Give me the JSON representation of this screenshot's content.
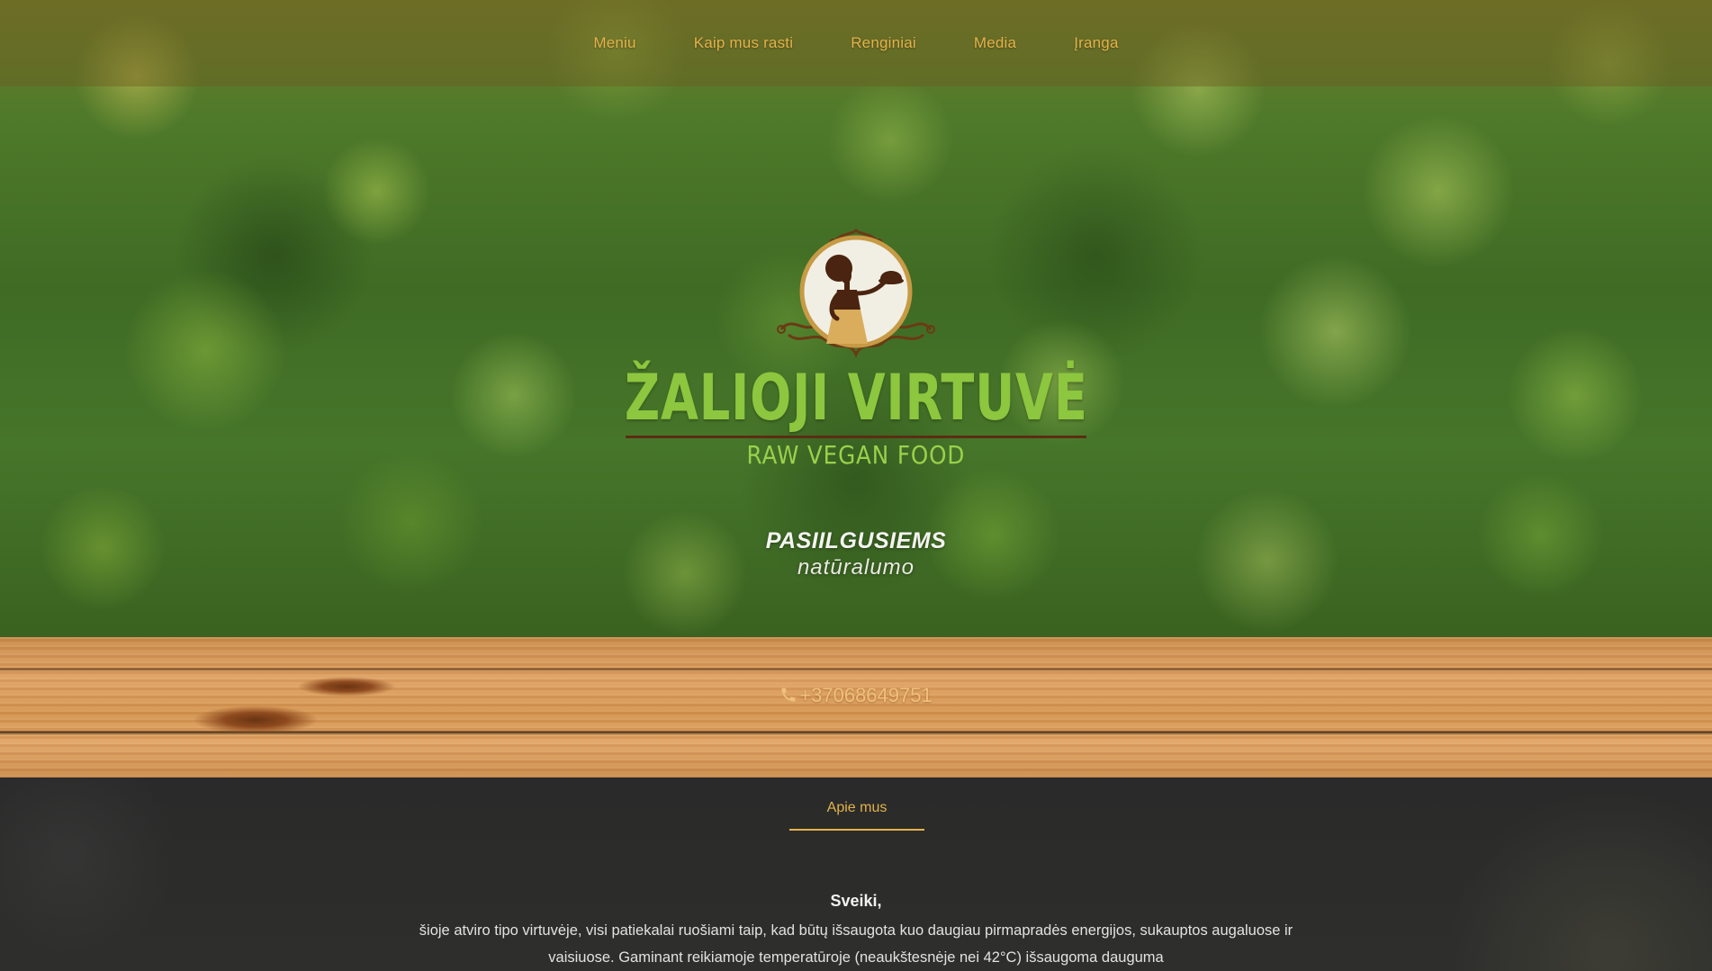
{
  "nav": {
    "items": [
      {
        "label": "Meniu"
      },
      {
        "label": "Kaip mus rasti"
      },
      {
        "label": "Renginiai"
      },
      {
        "label": "Media"
      },
      {
        "label": "Įranga"
      }
    ]
  },
  "brand": {
    "title": "ŽALIOJI  VIRTUVĖ",
    "subtitle": "RAW VEGAN FOOD",
    "emblem_icon": "waitress-emblem-icon"
  },
  "tagline": {
    "line1": "PASIILGUSIEMS",
    "line2": "natūralumo"
  },
  "contact": {
    "phone": "+37068649751",
    "phone_icon": "phone-icon"
  },
  "about": {
    "tab_label": "Apie mus",
    "greeting": "Sveiki,",
    "paragraph": "šioje atviro tipo virtuvėje, visi patiekalai ruošiami taip, kad būtų išsaugota kuo daugiau pirmapradės energijos, sukauptos augaluose ir vaisiuose. Gaminant reikiamoje temperatūroje (neaukštesnėje nei 42°C) išsaugoma dauguma"
  },
  "colors": {
    "nav_text": "#e3b24a",
    "brand_green": "#8dc63f",
    "brand_rule": "#5a2e12",
    "dark_section": "#2b2b2b"
  }
}
